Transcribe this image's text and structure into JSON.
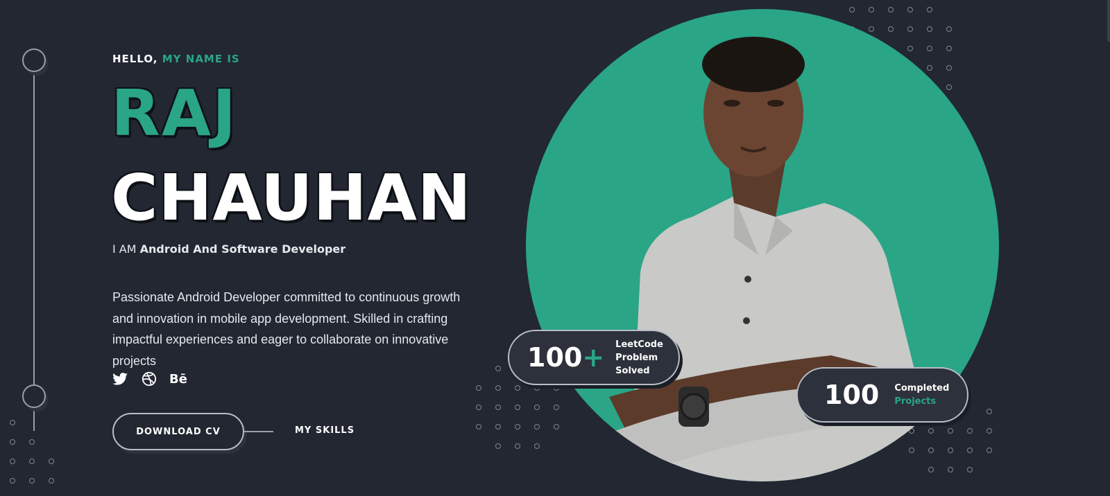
{
  "hero": {
    "hello_prefix": "HELLO,",
    "hello_accent": "MY NAME IS",
    "first_name": "RAJ",
    "last_name": "CHAUHAN",
    "role_prefix": "I AM",
    "role": "Android And Software Developer",
    "description": "Passionate Android Developer committed to continuous growth and innovation in mobile app development. Skilled in crafting impactful experiences and eager to collaborate on innovative projects"
  },
  "socials": {
    "behance_label": "Bē"
  },
  "buttons": {
    "download_cv": "DOWNLOAD CV",
    "my_skills": "MY SKILLS"
  },
  "stats": {
    "leetcode_value": "100",
    "leetcode_plus": "+",
    "leetcode_line1": "LeetCode",
    "leetcode_line2": "Problem Solved",
    "projects_value": "100",
    "projects_line1": "Completed",
    "projects_line2": "Projects"
  },
  "colors": {
    "background": "#222732",
    "accent": "#2aa586",
    "text": "#ffffff"
  }
}
